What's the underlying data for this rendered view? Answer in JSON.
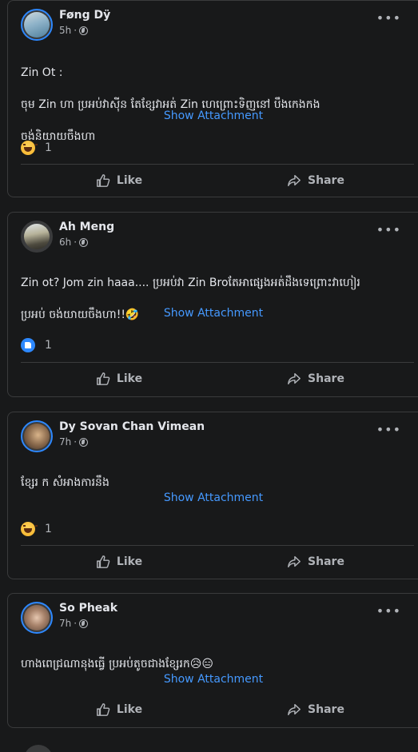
{
  "posts": [
    {
      "author": "Føng Dÿ",
      "time": "5h",
      "text_line1": "Zin Ot :",
      "text_line2": "ចុម Zin ហា ប្រអប់វាស៊ីន តែខ្សែវាអត់ Zin ហេព្រោះទិញនៅ បឹងកេងកង",
      "text_line3": "ចង់និយាយចឹងហា",
      "attachment_label": "Show Attachment",
      "reaction": "haha",
      "reaction_count": "1",
      "like_label": "Like",
      "share_label": "Share"
    },
    {
      "author": "Ah Meng",
      "time": "6h",
      "text_line1": "Zin ot? Jom zin haaa.... ប្រអប់វា Zin Broតែអាផ្សេងអត់ដឹងទេព្រោះវាហៀរ",
      "text_line2": "ប្រអប់ ចង់យាយចឹងហា!!🤣",
      "attachment_label": "Show Attachment",
      "reaction": "like",
      "reaction_count": "1",
      "like_label": "Like",
      "share_label": "Share"
    },
    {
      "author": "Dy Sovan Chan Vimean",
      "time": "7h",
      "text_line1": "ខ្សែរ ក សំអាងការនឹង",
      "attachment_label": "Show Attachment",
      "reaction": "haha",
      "reaction_count": "1",
      "like_label": "Like",
      "share_label": "Share"
    },
    {
      "author": "So Pheak",
      "time": "7h",
      "text_line1": "ហាងពេជ្រណានុងធ្វើ ប្រអប់តូចជាងខ្សែរក😥😑",
      "attachment_label": "Show Attachment",
      "like_label": "Like",
      "share_label": "Share"
    }
  ],
  "icons": {
    "more": "more-horizontal-icon",
    "privacy": "globe-icon",
    "like": "thumbs-up-icon",
    "share": "share-arrow-icon"
  },
  "colors": {
    "background": "#18191a",
    "link": "#4599ff",
    "secondary_text": "#b0b3b8",
    "primary_text": "#e4e6eb"
  }
}
